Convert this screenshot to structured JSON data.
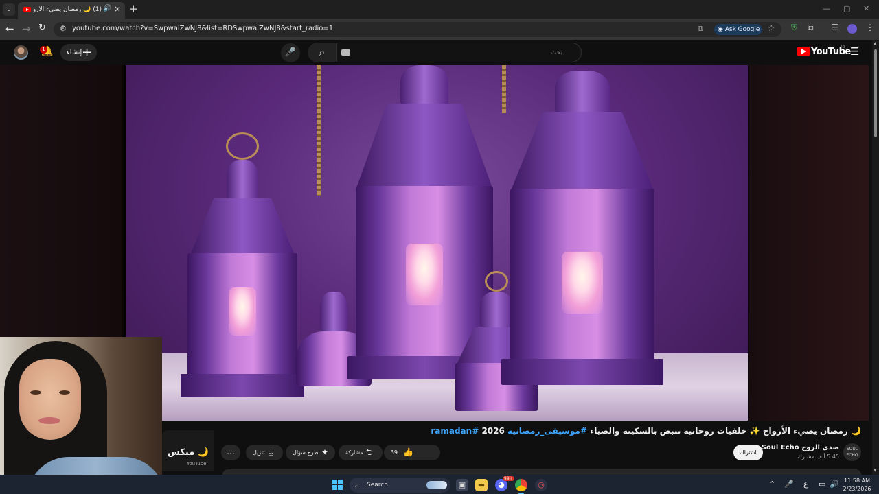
{
  "browser": {
    "tab": {
      "title": "(1) 🌙 رمضان يضيء الأرواح ✨",
      "audio_icon": "speaker-icon"
    },
    "window_controls": [
      "—",
      "▢",
      "✕"
    ],
    "address_bar": {
      "url": "youtube.com/watch?v=SwpwalZwNJ8&list=RDSwpwalZwNJ8&start_radio=1"
    },
    "ask_google_label": "Ask Google"
  },
  "youtube": {
    "logo_text": "YouTube",
    "country_code": "JO",
    "create_label": "إنشاء",
    "notification_count": "1",
    "search_placeholder": "بحث"
  },
  "video": {
    "title_main": "🌙 رمضان يضيء الأرواح ✨ خلفيات روحانية تنبض بالسكينة والضياء",
    "hashtag_1": "#موسيقى_رمضانية",
    "year": "2026",
    "hashtag_2": "#ramadan",
    "channel": {
      "name": "صدى الروح Soul Echo",
      "subscribers": "5.45 ألف مشترك",
      "logo_text": "SOUL ECHO"
    },
    "subscribe_label": "اشتراك",
    "like_count": "39",
    "share_label": "مشاركة",
    "ask_label": "طرح سؤال",
    "download_label": "تنزيل",
    "more_label": "…"
  },
  "playlist": {
    "title": "ميكس 🌙",
    "subtitle": "YouTube"
  },
  "taskbar": {
    "search_label": "Search",
    "language": "ع",
    "time": "11:58 AM",
    "date": "2/23/2026",
    "discord_badge": "99+"
  },
  "colors": {
    "youtube_red": "#ff0000",
    "link_blue": "#3ea6ff",
    "taskbar": "#1c2331"
  }
}
